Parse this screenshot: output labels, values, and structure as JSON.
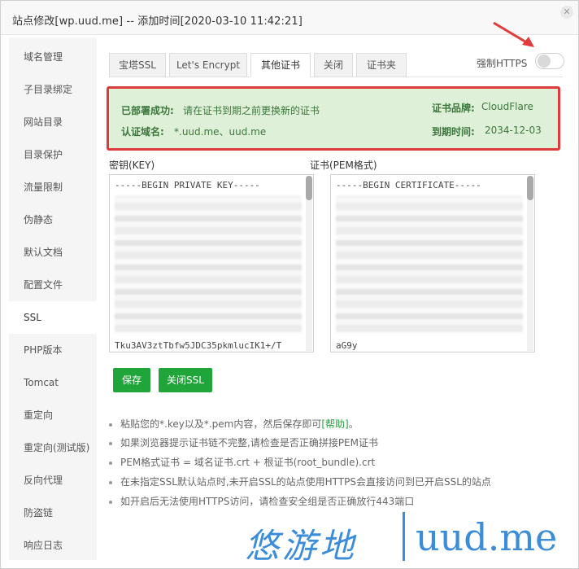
{
  "window": {
    "title": "站点修改[wp.uud.me] -- 添加时间[2020-03-10 11:42:21]",
    "close_icon": "close-icon"
  },
  "sidebar": {
    "items": [
      {
        "label": "域名管理"
      },
      {
        "label": "子目录绑定"
      },
      {
        "label": "网站目录"
      },
      {
        "label": "目录保护"
      },
      {
        "label": "流量限制"
      },
      {
        "label": "伪静态"
      },
      {
        "label": "默认文档"
      },
      {
        "label": "配置文件"
      },
      {
        "label": "SSL",
        "active": true
      },
      {
        "label": "PHP版本"
      },
      {
        "label": "Tomcat"
      },
      {
        "label": "重定向"
      },
      {
        "label": "重定向(测试版)"
      },
      {
        "label": "反向代理"
      },
      {
        "label": "防盗链"
      },
      {
        "label": "响应日志"
      }
    ]
  },
  "tabs": [
    {
      "label": "宝塔SSL"
    },
    {
      "label": "Let's Encrypt"
    },
    {
      "label": "其他证书",
      "active": true
    },
    {
      "label": "关闭"
    },
    {
      "label": "证书夹"
    }
  ],
  "force_https": {
    "label": "强制HTTPS",
    "enabled": false
  },
  "cert_info": {
    "deployed_label": "已部署成功:",
    "deployed_text": "请在证书到期之前更换新的证书",
    "domain_label": "认证域名:",
    "domain_value": "*.uud.me、uud.me",
    "brand_label": "证书品牌:",
    "brand_value": "CloudFlare",
    "expire_label": "到期时间:",
    "expire_value": "2034-12-03"
  },
  "key_box": {
    "label": "密钥(KEY)",
    "first_line": "-----BEGIN PRIVATE KEY-----",
    "last_line": "Tku3AV3ztTbfw5JDC35pkmlucIK1+/T"
  },
  "cert_box": {
    "label": "证书(PEM格式)",
    "first_line": "-----BEGIN CERTIFICATE-----",
    "last_line": "aG9y"
  },
  "buttons": {
    "save": "保存",
    "close_ssl": "关闭SSL"
  },
  "notes": {
    "n1_text": "粘贴您的*.key以及*.pem内容，然后保存即可",
    "n1_link": "[帮助]",
    "n1_tail": "。",
    "n2": "如果浏览器提示证书链不完整,请检查是否正确拼接PEM证书",
    "n3": "PEM格式证书 = 域名证书.crt + 根证书(root_bundle).crt",
    "n4": "在未指定SSL默认站点时,未开启SSL的站点使用HTTPS会直接访问到已开启SSL的站点",
    "n5": "如开启后无法使用HTTPS访问，请检查安全组是否正确放行443端口"
  },
  "watermark": {
    "cn": "悠游地",
    "en": "uud.me"
  },
  "colors": {
    "accent_green": "#20a53a",
    "info_bg": "#dff0d8",
    "info_text": "#3c763d",
    "highlight_red": "#dd3b3b",
    "watermark_blue": "#3b8cd9"
  }
}
